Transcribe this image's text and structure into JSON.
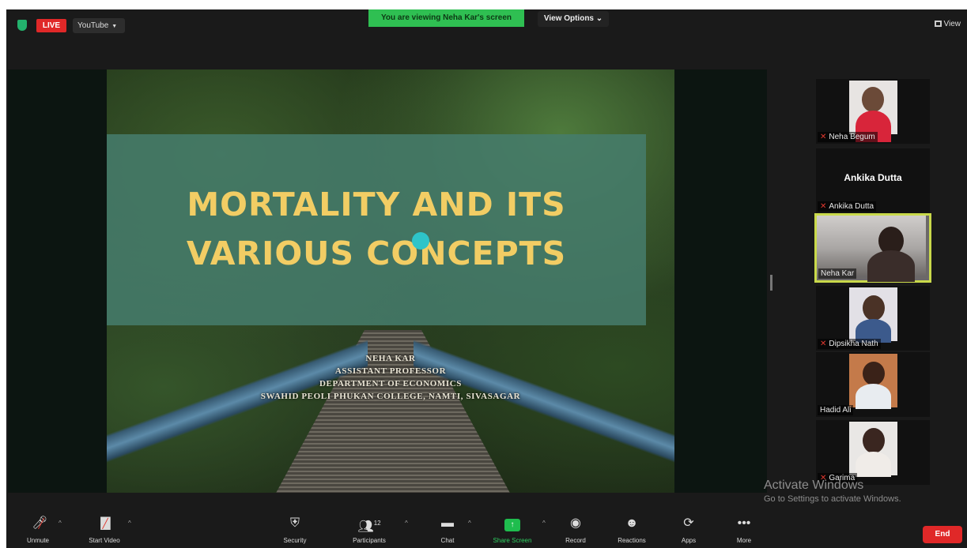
{
  "topbar": {
    "live_label": "LIVE",
    "youtube_label": "YouTube",
    "viewing_banner": "You are viewing Neha Kar's screen",
    "view_options_label": "View Options",
    "view_label": "View"
  },
  "slide": {
    "title_line1": "MORTALITY AND ITS",
    "title_line2": "VARIOUS CONCEPTS",
    "author": "NEHA KAR",
    "role": "ASSISTANT PROFESSOR",
    "department": "DEPARTMENT OF ECONOMICS",
    "college": "SWAHID PEOLI PHUKAN COLLEGE, NAMTI, SIVASAGAR"
  },
  "participants": [
    {
      "name": "Neha Begum",
      "muted": true
    },
    {
      "name": "Ankika Dutta",
      "display": "Ankika Dutta",
      "muted": true
    },
    {
      "name": "Neha Kar",
      "muted": false,
      "active_speaker": true
    },
    {
      "name": "Dipsikha Nath",
      "muted": true
    },
    {
      "name": "Hadid Ali",
      "muted": false
    },
    {
      "name": "Garima",
      "muted": true
    }
  ],
  "watermark": {
    "line1": "Activate Windows",
    "line2": "Go to Settings to activate Windows."
  },
  "toolbar": {
    "unmute": "Unmute",
    "start_video": "Start Video",
    "security": "Security",
    "participants": "Participants",
    "participants_count": "12",
    "chat": "Chat",
    "share_screen": "Share Screen",
    "record": "Record",
    "reactions": "Reactions",
    "apps": "Apps",
    "more": "More",
    "end": "End"
  },
  "colors": {
    "live": "#e02828",
    "viewing_banner": "#2fbf52",
    "slide_title": "#f2cd64",
    "active_border": "#c9d94a",
    "end": "#e02828"
  },
  "icons": [
    "shield-icon",
    "caret-down-icon",
    "grid-view-icon",
    "mic-muted-icon",
    "video-off-icon",
    "security-icon",
    "participants-icon",
    "chat-icon",
    "share-screen-icon",
    "record-icon",
    "reactions-icon",
    "apps-icon",
    "more-icon"
  ]
}
